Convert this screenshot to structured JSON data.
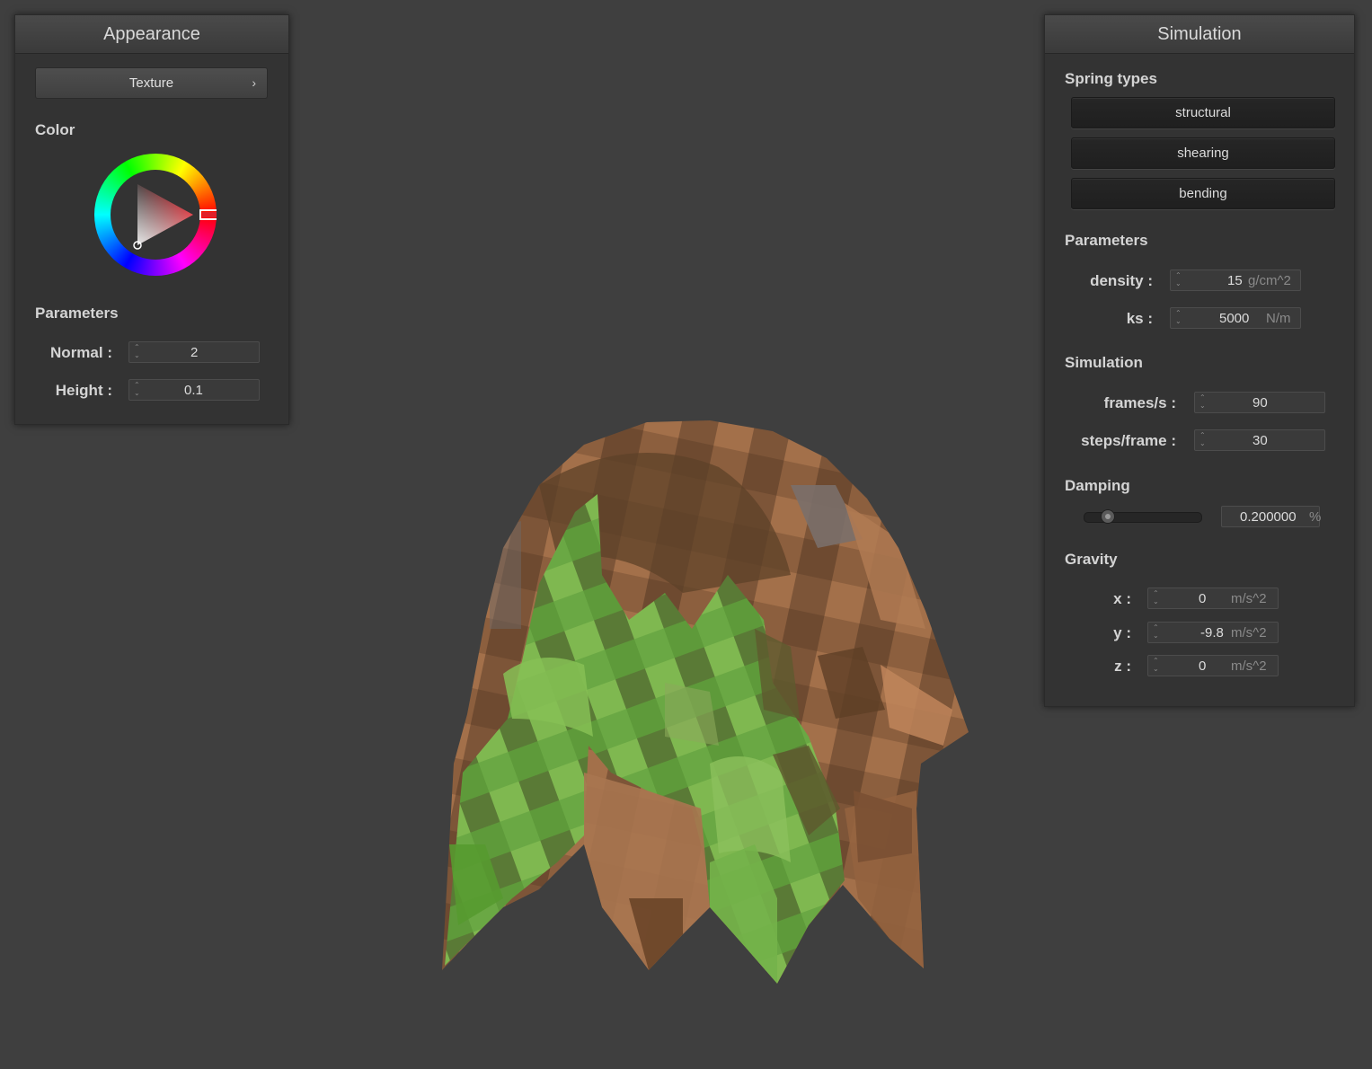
{
  "appearance": {
    "title": "Appearance",
    "texture_button": "Texture",
    "chevron": "›",
    "color_label": "Color",
    "params_label": "Parameters",
    "normal_label": "Normal :",
    "normal_value": "2",
    "height_label": "Height :",
    "height_value": "0.1",
    "selected_color": "#e0202a"
  },
  "simulation": {
    "title": "Simulation",
    "spring_types_label": "Spring types",
    "springs": [
      "structural",
      "shearing",
      "bending"
    ],
    "params_label": "Parameters",
    "density_label": "density :",
    "density_value": "15",
    "density_unit": "g/cm^2",
    "ks_label": "ks :",
    "ks_value": "5000",
    "ks_unit": "N/m",
    "sim_label": "Simulation",
    "fps_label": "frames/s :",
    "fps_value": "90",
    "steps_label": "steps/frame :",
    "steps_value": "30",
    "damping_label": "Damping",
    "damping_value": "0.200000",
    "damping_unit": "%",
    "damping_fraction": 0.2,
    "gravity_label": "Gravity",
    "gx_label": "x :",
    "gx_value": "0",
    "gy_label": "y :",
    "gy_value": "-9.8",
    "gz_label": "z :",
    "gz_value": "0",
    "g_unit": "m/s^2"
  },
  "cloth": {
    "colors": {
      "brown": "#8c5f3e",
      "dark_brown": "#5e4128",
      "tan": "#b07a52",
      "green": "#6aa844",
      "light_green": "#86bf55",
      "olive": "#5e5a2e",
      "grey": "#7a6f6a"
    }
  }
}
